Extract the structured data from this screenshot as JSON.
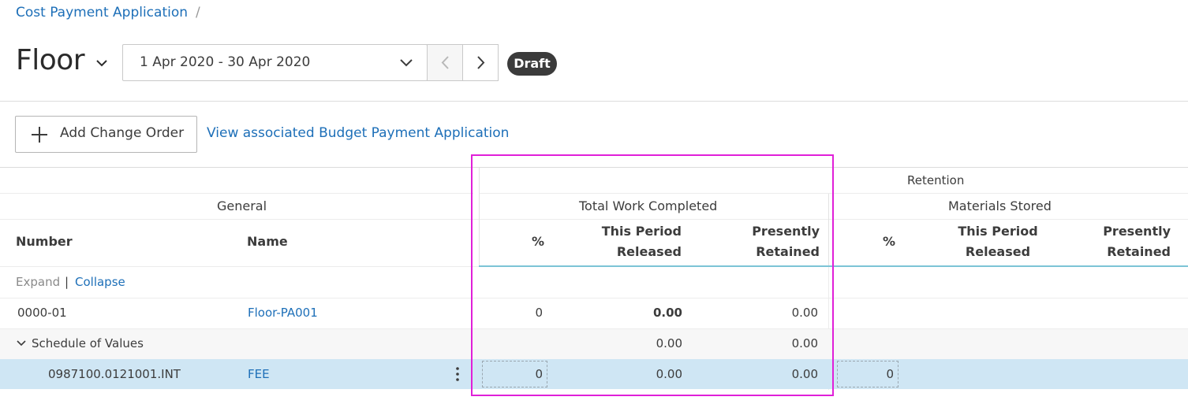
{
  "breadcrumb": {
    "root": "Cost Payment Application",
    "separator": "/"
  },
  "title": {
    "text": "Floor",
    "chevron_icon": "chevron-down-icon"
  },
  "period": {
    "value": "1 Apr 2020 - 30 Apr 2020",
    "prev_icon": "chevron-left-icon",
    "next_icon": "chevron-right-icon"
  },
  "status_badge": "Draft",
  "toolbar": {
    "add_change_order": "Add Change Order",
    "view_budget_link": "View associated Budget Payment Application"
  },
  "table": {
    "group_headers": {
      "general": "General",
      "retention": "Retention",
      "total_work_completed": "Total Work Completed",
      "materials_stored": "Materials Stored"
    },
    "columns": {
      "number": "Number",
      "name": "Name",
      "twc_pct": "%",
      "twc_this_period_1": "This Period",
      "twc_this_period_2": "Released",
      "twc_presently_1": "Presently",
      "twc_presently_2": "Retained",
      "ms_pct": "%",
      "ms_this_period_1": "This Period",
      "ms_this_period_2": "Released",
      "ms_presently_1": "Presently",
      "ms_presently_2": "Retained"
    },
    "expand_label": "Expand",
    "pipe": "|",
    "collapse_label": "Collapse",
    "rows": [
      {
        "number": "0000-01",
        "name": "Floor-PA001",
        "twc_pct": "0",
        "twc_this_period": "0.00",
        "twc_presently": "0.00"
      },
      {
        "number": "Schedule of Values",
        "twc_this_period": "0.00",
        "twc_presently": "0.00"
      },
      {
        "number": "0987100.0121001.INT",
        "name": "FEE",
        "twc_pct": "0",
        "twc_this_period": "0.00",
        "twc_presently": "0.00",
        "ms_pct": "0"
      }
    ]
  },
  "colors": {
    "link": "#1d6fb8",
    "selected_row": "#cfe6f4",
    "highlight_box": "#e020d8",
    "badge_bg": "#3b3b3b"
  }
}
